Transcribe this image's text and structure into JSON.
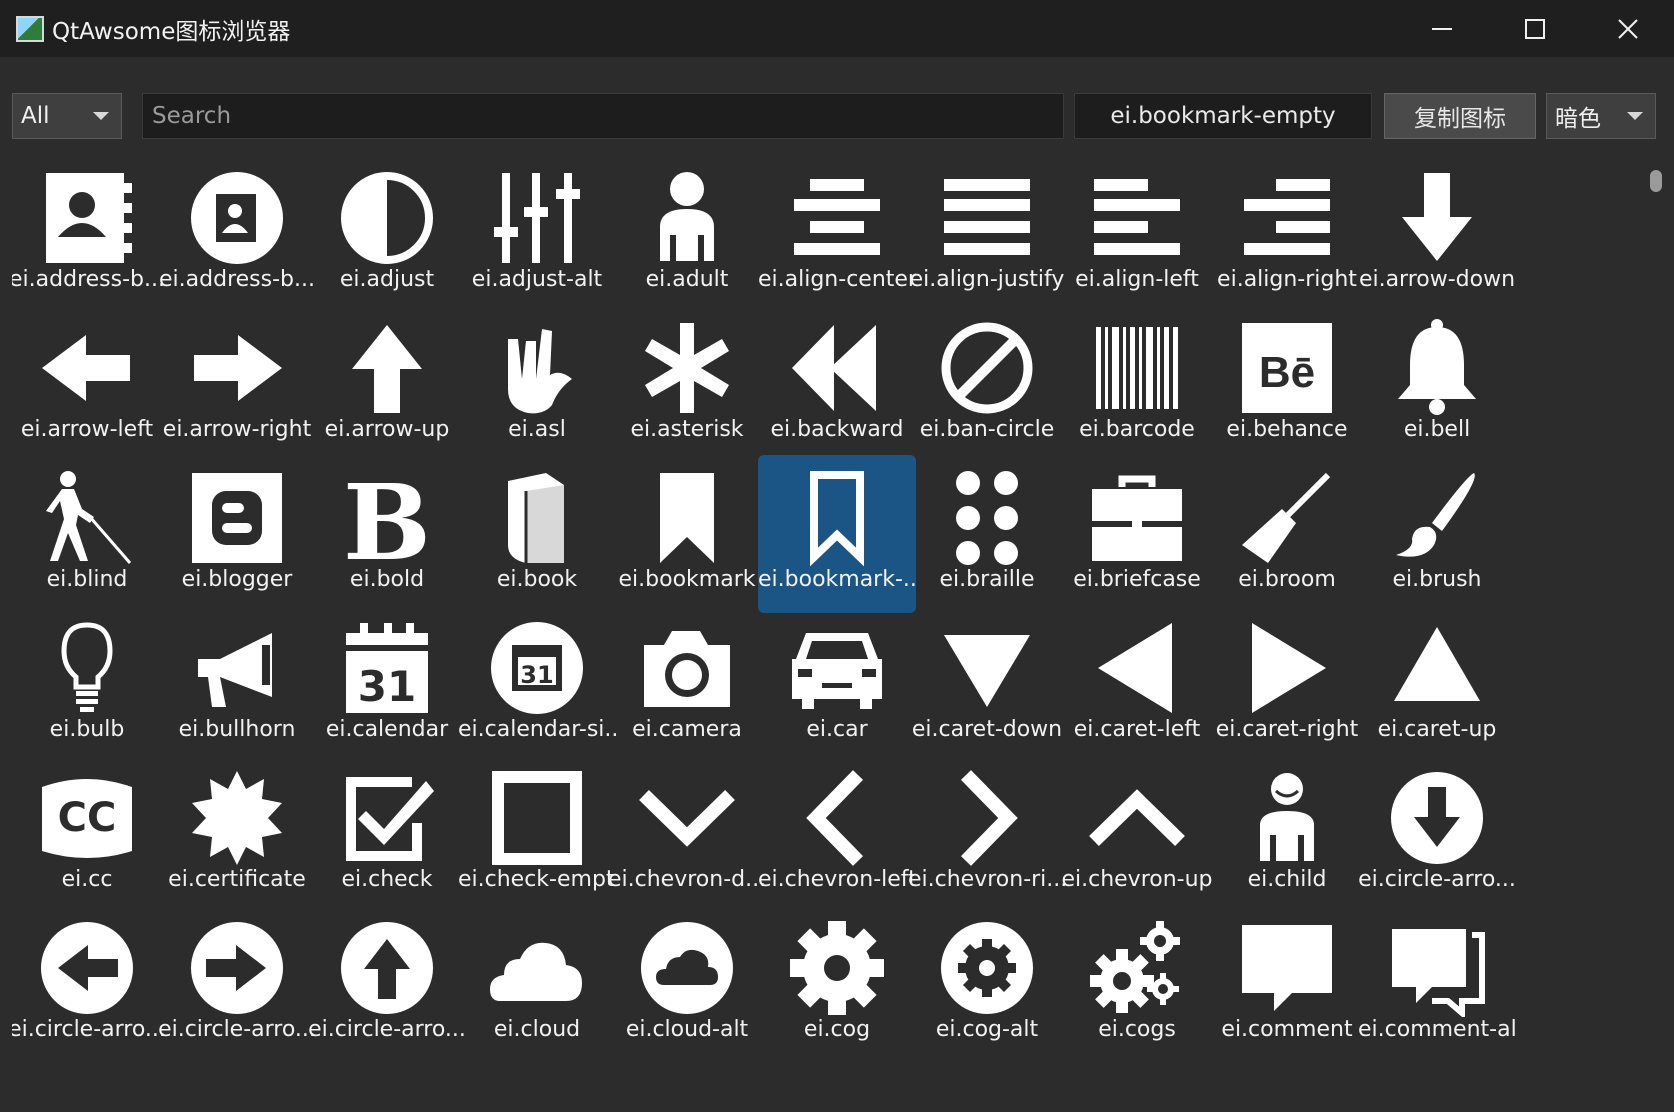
{
  "window": {
    "title": "QtAwsome图标浏览器",
    "controls": [
      "minimize-icon",
      "maximize-icon",
      "close-icon"
    ]
  },
  "toolbar": {
    "filter_value": "All",
    "search_placeholder": "Search",
    "selected_name": "ei.bookmark-empty",
    "copy_label": "复制图标",
    "theme_value": "暗色"
  },
  "icons": [
    {
      "label": "ei.address-b...",
      "icon": "address-book-icon"
    },
    {
      "label": "ei.address-b...",
      "icon": "address-book-alt-icon"
    },
    {
      "label": "ei.adjust",
      "icon": "adjust-icon"
    },
    {
      "label": "ei.adjust-alt",
      "icon": "adjust-alt-icon"
    },
    {
      "label": "ei.adult",
      "icon": "adult-icon"
    },
    {
      "label": "ei.align-center",
      "icon": "align-center-icon"
    },
    {
      "label": "ei.align-justify",
      "icon": "align-justify-icon"
    },
    {
      "label": "ei.align-left",
      "icon": "align-left-icon"
    },
    {
      "label": "ei.align-right",
      "icon": "align-right-icon"
    },
    {
      "label": "ei.arrow-down",
      "icon": "arrow-down-icon"
    },
    {
      "label": "ei.arrow-left",
      "icon": "arrow-left-icon"
    },
    {
      "label": "ei.arrow-right",
      "icon": "arrow-right-icon"
    },
    {
      "label": "ei.arrow-up",
      "icon": "arrow-up-icon"
    },
    {
      "label": "ei.asl",
      "icon": "asl-icon"
    },
    {
      "label": "ei.asterisk",
      "icon": "asterisk-icon"
    },
    {
      "label": "ei.backward",
      "icon": "backward-icon"
    },
    {
      "label": "ei.ban-circle",
      "icon": "ban-circle-icon"
    },
    {
      "label": "ei.barcode",
      "icon": "barcode-icon"
    },
    {
      "label": "ei.behance",
      "icon": "behance-icon"
    },
    {
      "label": "ei.bell",
      "icon": "bell-icon"
    },
    {
      "label": "ei.blind",
      "icon": "blind-icon"
    },
    {
      "label": "ei.blogger",
      "icon": "blogger-icon"
    },
    {
      "label": "ei.bold",
      "icon": "bold-icon"
    },
    {
      "label": "ei.book",
      "icon": "book-icon"
    },
    {
      "label": "ei.bookmark",
      "icon": "bookmark-icon"
    },
    {
      "label": "ei.bookmark-...",
      "icon": "bookmark-empty-icon",
      "selected": true
    },
    {
      "label": "ei.braille",
      "icon": "braille-icon"
    },
    {
      "label": "ei.briefcase",
      "icon": "briefcase-icon"
    },
    {
      "label": "ei.broom",
      "icon": "broom-icon"
    },
    {
      "label": "ei.brush",
      "icon": "brush-icon"
    },
    {
      "label": "ei.bulb",
      "icon": "bulb-icon"
    },
    {
      "label": "ei.bullhorn",
      "icon": "bullhorn-icon"
    },
    {
      "label": "ei.calendar",
      "icon": "calendar-icon",
      "text": "31"
    },
    {
      "label": "ei.calendar-si...",
      "icon": "calendar-sign-icon",
      "text": "31"
    },
    {
      "label": "ei.camera",
      "icon": "camera-icon"
    },
    {
      "label": "ei.car",
      "icon": "car-icon"
    },
    {
      "label": "ei.caret-down",
      "icon": "caret-down-icon"
    },
    {
      "label": "ei.caret-left",
      "icon": "caret-left-icon"
    },
    {
      "label": "ei.caret-right",
      "icon": "caret-right-icon"
    },
    {
      "label": "ei.caret-up",
      "icon": "caret-up-icon"
    },
    {
      "label": "ei.cc",
      "icon": "cc-icon",
      "text": "CC"
    },
    {
      "label": "ei.certificate",
      "icon": "certificate-icon"
    },
    {
      "label": "ei.check",
      "icon": "check-icon"
    },
    {
      "label": "ei.check-empty",
      "icon": "check-empty-icon"
    },
    {
      "label": "ei.chevron-d...",
      "icon": "chevron-down-icon"
    },
    {
      "label": "ei.chevron-left",
      "icon": "chevron-left-icon"
    },
    {
      "label": "ei.chevron-ri...",
      "icon": "chevron-right-icon"
    },
    {
      "label": "ei.chevron-up",
      "icon": "chevron-up-icon"
    },
    {
      "label": "ei.child",
      "icon": "child-icon"
    },
    {
      "label": "ei.circle-arro...",
      "icon": "circle-arrow-down-icon"
    },
    {
      "label": "ei.circle-arro...",
      "icon": "circle-arrow-left-icon"
    },
    {
      "label": "ei.circle-arro...",
      "icon": "circle-arrow-right-icon"
    },
    {
      "label": "ei.circle-arro...",
      "icon": "circle-arrow-up-icon"
    },
    {
      "label": "ei.cloud",
      "icon": "cloud-icon"
    },
    {
      "label": "ei.cloud-alt",
      "icon": "cloud-alt-icon"
    },
    {
      "label": "ei.cog",
      "icon": "cog-icon"
    },
    {
      "label": "ei.cog-alt",
      "icon": "cog-alt-icon"
    },
    {
      "label": "ei.cogs",
      "icon": "cogs-icon"
    },
    {
      "label": "ei.comment",
      "icon": "comment-icon"
    },
    {
      "label": "ei.comment-alt",
      "icon": "comment-alt-icon"
    }
  ],
  "colors": {
    "background": "#2c2c2c",
    "titlebar": "#1f1f1f",
    "selection": "#1b5585",
    "icon": "#ffffff"
  }
}
